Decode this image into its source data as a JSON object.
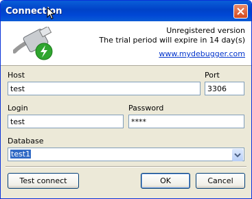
{
  "window": {
    "title": "Connection"
  },
  "header": {
    "status": "Unregistered version",
    "trial_message": "The trial period will expire in 14 day(s)",
    "website": "www.mydebugger.com"
  },
  "form": {
    "host_label": "Host",
    "host_value": "test",
    "port_label": "Port",
    "port_value": "3306",
    "login_label": "Login",
    "login_value": "test",
    "password_label": "Password",
    "password_value": "****",
    "database_label": "Database",
    "database_value": "test1"
  },
  "buttons": {
    "test_connect": "Test connect",
    "ok": "OK",
    "cancel": "Cancel"
  },
  "icons": {
    "close": "close-icon",
    "plug": "plug-icon",
    "cursor": "cursor-icon",
    "dropdown": "chevron-down-icon"
  }
}
